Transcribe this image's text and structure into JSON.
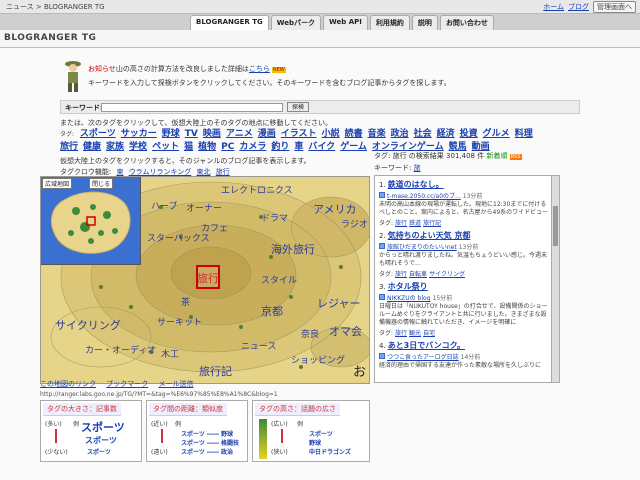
{
  "topbar": {
    "crumb": "ニュース > BLOGRANGER TG",
    "account_links": [
      "ホーム",
      "ブログ"
    ],
    "account_button": "管理画面へ"
  },
  "tabs": [
    "BLOGRANGER TG",
    "Webパーク",
    "Web API",
    "利用規約",
    "説明",
    "お問い合わせ"
  ],
  "site_name": "BLOGRANGER TG",
  "intro": {
    "line1_prefix": "お知らせ",
    "line1": "山の高さの計算方法を改良しました詳細は",
    "line1_link": "こちら",
    "line1_badge": "NEW",
    "line2": "キーワードを入力して探検ボタンをクリックしてください。そのキーワードを含むブログ記事からタグを探します。"
  },
  "search": {
    "label": "キーワード:",
    "value": "",
    "button": "探検"
  },
  "note1": "または、次のタグをクリックして、仮想大陸上のそのタグの地点に移動してください。",
  "tags": {
    "prefix": "タグ:",
    "items": [
      "スポーツ",
      "サッカー",
      "野球",
      "TV",
      "映画",
      "アニメ",
      "漫画",
      "イラスト",
      "小説",
      "読書",
      "音楽",
      "政治",
      "社会",
      "経済",
      "投資",
      "グルメ",
      "料理",
      "旅行",
      "健康",
      "家族",
      "学校",
      "ペット",
      "猫",
      "植物",
      "PC",
      "カメラ",
      "釣り",
      "車",
      "バイク",
      "ゲーム",
      "オンラインゲーム",
      "競馬",
      "動画"
    ]
  },
  "note2": "仮想大陸上のタグをクリックすると、そのジャンルのブログ記事を表示します。",
  "map_tabs": {
    "label": "タグクロウ機能:",
    "links": [
      "東",
      "ウラムリランキング",
      "東北",
      "旅行"
    ]
  },
  "mini_map": {
    "btn1": "広域地図",
    "btn2": "閉じる"
  },
  "map_labels": [
    "エレクトロニクス",
    "ハーブ",
    "オーナー",
    "ドラマ",
    "アメリカ",
    "カフェ",
    "ラジオ",
    "スターバックス",
    "海外旅行",
    "旅行",
    "スタイル",
    "京都",
    "レジャー",
    "サイクリング",
    "オマ会",
    "サーキット",
    "旅行記",
    "ニュース",
    "お",
    "ショッピング",
    "カー・オーディオ",
    "木工",
    "茶",
    "奈良"
  ],
  "map_links": [
    "この地図のリンク",
    "ブックマーク",
    "メール送信"
  ],
  "url": "http://ranger.labs.goo.ne.jp/TG/?MT=&tag=%E6%97%85%E8%A1%8C&blog=1",
  "legend": {
    "size": {
      "title": "タグの大きさ：記事数",
      "many": "(多い)",
      "few": "(少ない)",
      "example_label": "例",
      "big": "スポーツ",
      "mid": "スポーツ",
      "small": "スポーツ"
    },
    "distance": {
      "title": "タグ間の距離：類似度",
      "near": "(近い)",
      "far": "(遠い)",
      "example_label": "例",
      "e1": "スポーツ ―― 野球",
      "e2": "スポーツ ―― 格闘技",
      "e3": "スポーツ ―― 政治"
    },
    "height": {
      "title": "タグの高さ：話題の広さ",
      "wide": "(広い)",
      "narrow": "(狭い)",
      "example_label": "例",
      "e1": "スポーツ",
      "e2": "野球",
      "e3": "中日ドラゴンズ"
    }
  },
  "results": {
    "header": "タグ: 旅行 の検索結果 301,408 件",
    "new_label": "新着順",
    "rss": "RSS",
    "keyword_label": "キーワード:",
    "keyword_value": "旅",
    "items": [
      {
        "num": "1.",
        "title": "鉄道のはなし。",
        "source": "t-mase.2050.cc/a0のブ...",
        "ago": "13分前",
        "body": "未明の高山本線の現場が運転した。現地に12:30までに付けるべしとのこと。案内によると、名古屋から49系のワイドビュー",
        "tags": [
          "旅行",
          "鉄道",
          "旅行記"
        ]
      },
      {
        "num": "2.",
        "title": "気持ちのよい天気 京都",
        "source": "旅館ひだまりのたいいnet",
        "ago": "13分前",
        "body": "からっと晴れ渡りましたね。気温もちょうどいい感じ。今週末も晴れそうで...",
        "tags": [
          "旅行",
          "自転車",
          "サイクリング"
        ]
      },
      {
        "num": "3.",
        "title": "ホタル祭り",
        "source": "NIKKZUの blog",
        "ago": "15分前",
        "body": "日曜日は「NUKUTOY house」の打合せで、設備関係のショールームめぐりをクライアントと共に行いました。きまざまな設備機器の情報に触れていただき、イメージを明確に",
        "tags": [
          "旅行",
          "観光",
          "自宅"
        ]
      },
      {
        "num": "4.",
        "title": "あと3日でバンコク。",
        "source": "つつこ食ったアーログ日誌",
        "ago": "14分前",
        "body": "経済的理由で帰国する友達が作った素敵な場所を久しぶりに",
        "tags": []
      }
    ]
  }
}
